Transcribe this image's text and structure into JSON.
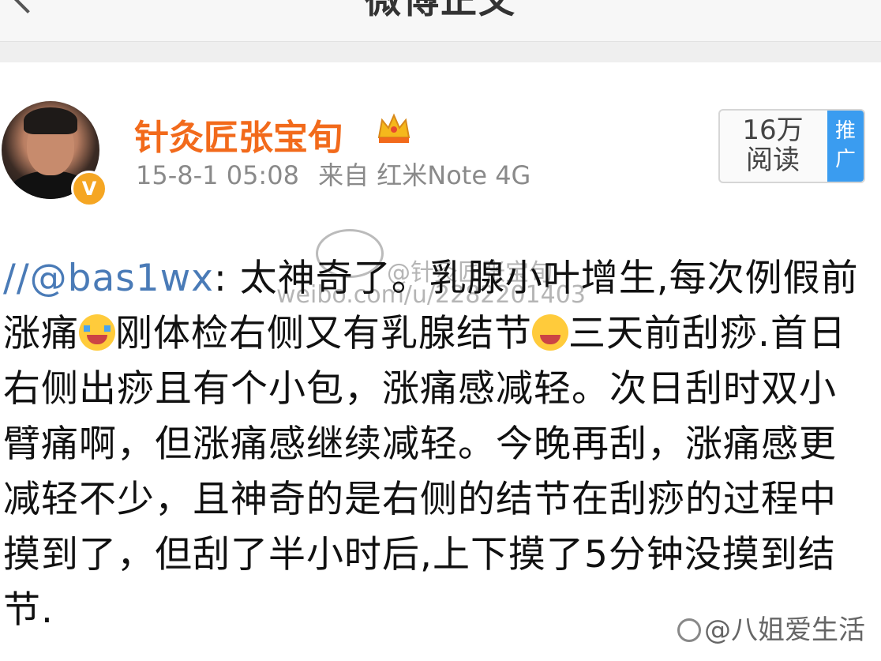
{
  "header": {
    "title": "微博正文"
  },
  "post": {
    "author": "针灸匠张宝旬",
    "verified_badge": "V",
    "timestamp": "15-8-1 05:08",
    "source": "来自 红米Note 4G",
    "read_count": "16万",
    "read_label": "阅读",
    "promo_label_1": "推",
    "promo_label_2": "广",
    "mention": "//@bas1wx",
    "text_1": ": 太神奇了。乳腺小叶增生,每次例假前涨痛",
    "text_2": "刚体检右侧又有乳腺结节",
    "text_3": "三天前刮痧.首日右侧出痧且有个小包，涨痛感减轻。次日刮时双小臂痛啊，但涨痛感继续减轻。今晚再刮，涨痛感更减轻不少，且神奇的是右侧的结节在刮痧的过程中摸到了，但刮了半小时后,上下摸了5分钟没摸到结节."
  },
  "watermark": {
    "line1": "@针灸匠张宝旬",
    "line2": "weibo.com/u/2282201403"
  },
  "footer": {
    "credit": "@八姐爱生活"
  },
  "colors": {
    "author": "#f26a1b",
    "mention": "#4a7bb7",
    "promo": "#3a9cf0"
  },
  "icons": [
    "back-arrow-icon",
    "crown-icon",
    "verified-icon",
    "crying-emoji-icon",
    "scared-emoji-icon",
    "weibo-logo-icon",
    "paw-icon"
  ]
}
